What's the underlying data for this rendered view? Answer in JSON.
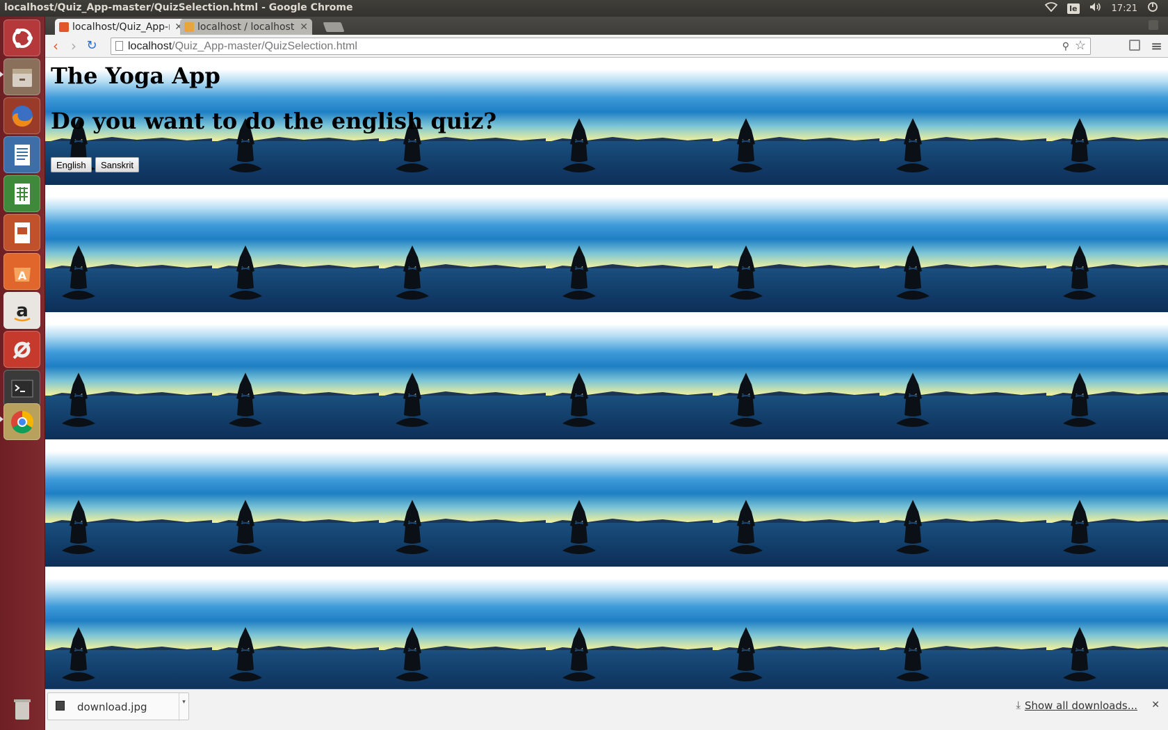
{
  "window_title": "localhost/Quiz_App-master/QuizSelection.html - Google Chrome",
  "system": {
    "keyboard_layout": "Ie",
    "time": "17:21"
  },
  "tabs": [
    {
      "label": "localhost/Quiz_App-master/QuizSelection.html",
      "active": true
    },
    {
      "label": "localhost / localhost",
      "active": false
    }
  ],
  "address_bar": {
    "host": "localhost",
    "path": "/Quiz_App-master/QuizSelection.html"
  },
  "page": {
    "title": "The Yoga App",
    "question": "Do you want to do the english quiz?",
    "buttons": {
      "english": "English",
      "sanskrit": "Sanskrit"
    }
  },
  "downloads": {
    "file_name": "download.jpg",
    "show_all_label": "Show all downloads..."
  },
  "launcher": [
    "ubuntu-dash",
    "files",
    "firefox",
    "libreoffice-writer",
    "libreoffice-calc",
    "libreoffice-impress",
    "software-center",
    "amazon",
    "system-settings",
    "terminal",
    "chrome",
    "trash"
  ]
}
